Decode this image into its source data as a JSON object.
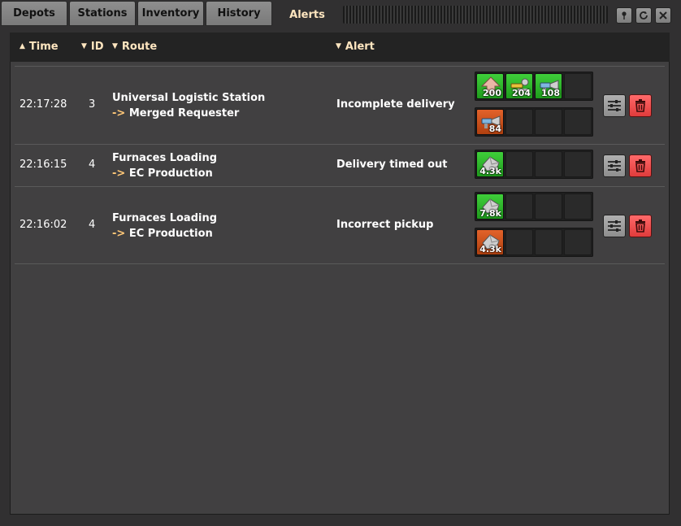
{
  "tabs": [
    {
      "label": "Depots"
    },
    {
      "label": "Stations"
    },
    {
      "label": "Inventory"
    },
    {
      "label": "History"
    },
    {
      "label": "Alerts"
    }
  ],
  "active_tab": "Alerts",
  "title_buttons": [
    {
      "icon": "pin-icon"
    },
    {
      "icon": "refresh-icon"
    },
    {
      "icon": "close-icon"
    }
  ],
  "columns": {
    "time": "Time",
    "id": "ID",
    "route": "Route",
    "alert": "Alert"
  },
  "alerts": [
    {
      "time": "22:17:28",
      "id": "3",
      "route_from": "Universal Logistic Station",
      "route_arrow": "->",
      "route_to": "Merged Requester",
      "alert": "Incomplete delivery",
      "slot_rows": [
        [
          {
            "color": "green",
            "icon": "item-plate-icon",
            "count": "200"
          },
          {
            "color": "green",
            "icon": "item-wrench-icon",
            "count": "204"
          },
          {
            "color": "green",
            "icon": "item-drill-icon",
            "count": "108"
          }
        ],
        [
          {
            "color": "orange",
            "icon": "item-drill-icon",
            "count": "84"
          }
        ]
      ]
    },
    {
      "time": "22:16:15",
      "id": "4",
      "route_from": "Furnaces Loading",
      "route_arrow": "->",
      "route_to": "EC Production",
      "alert": "Delivery timed out",
      "slot_rows": [
        [
          {
            "color": "green",
            "icon": "item-ore-icon",
            "count": "4.3k"
          }
        ]
      ]
    },
    {
      "time": "22:16:02",
      "id": "4",
      "route_from": "Furnaces Loading",
      "route_arrow": "->",
      "route_to": "EC Production",
      "alert": "Incorrect pickup",
      "slot_rows": [
        [
          {
            "color": "green",
            "icon": "item-ore-icon",
            "count": "7.8k"
          }
        ],
        [
          {
            "color": "orange",
            "icon": "item-ore-icon",
            "count": "4.3k"
          }
        ]
      ]
    }
  ]
}
